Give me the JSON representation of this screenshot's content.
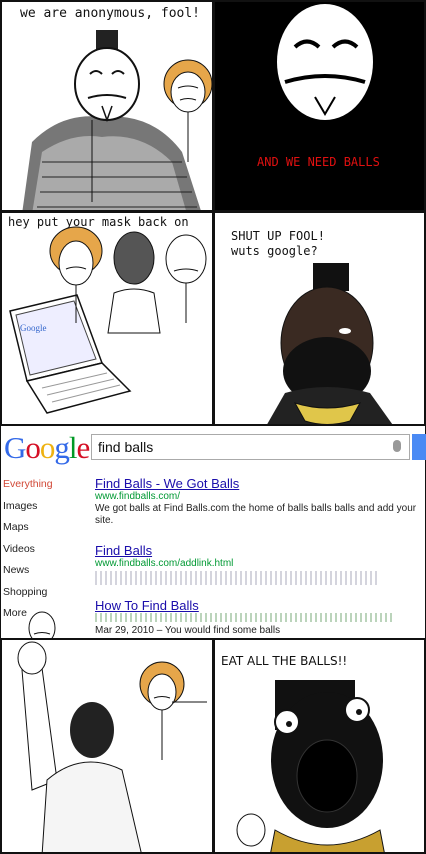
{
  "panel1": {
    "caption": "we are anonymous, fool!"
  },
  "panel2": {
    "caption": "AND WE NEED BALLS"
  },
  "panel3": {
    "caption": "hey put your mask back on"
  },
  "panel4": {
    "caption_line1": "SHUT UP FOOL!",
    "caption_line2": "wuts google?"
  },
  "google": {
    "logo": "Google",
    "query": "find balls",
    "sidebar": [
      "Everything",
      "Images",
      "Maps",
      "Videos",
      "News",
      "Shopping",
      "More"
    ],
    "results": [
      {
        "title": "Find Balls - We Got Balls",
        "url": "www.findballs.com/",
        "snippet": "We got balls at Find Balls.com the home of balls balls balls and add your site."
      },
      {
        "title": "Find Balls",
        "url": "www.findballs.com/addlink.html",
        "snippet": ""
      },
      {
        "title": "How To Find Balls",
        "url": "",
        "snippet": "Mar 29, 2010 – You would find some balls"
      }
    ]
  },
  "panel6": {
    "caption": "EAT ALL THE BALLS!!"
  },
  "colors": {
    "caption_red": "#e01010",
    "google_blue": "#4a8af4",
    "link": "#1a0dab",
    "url_green": "#093"
  }
}
